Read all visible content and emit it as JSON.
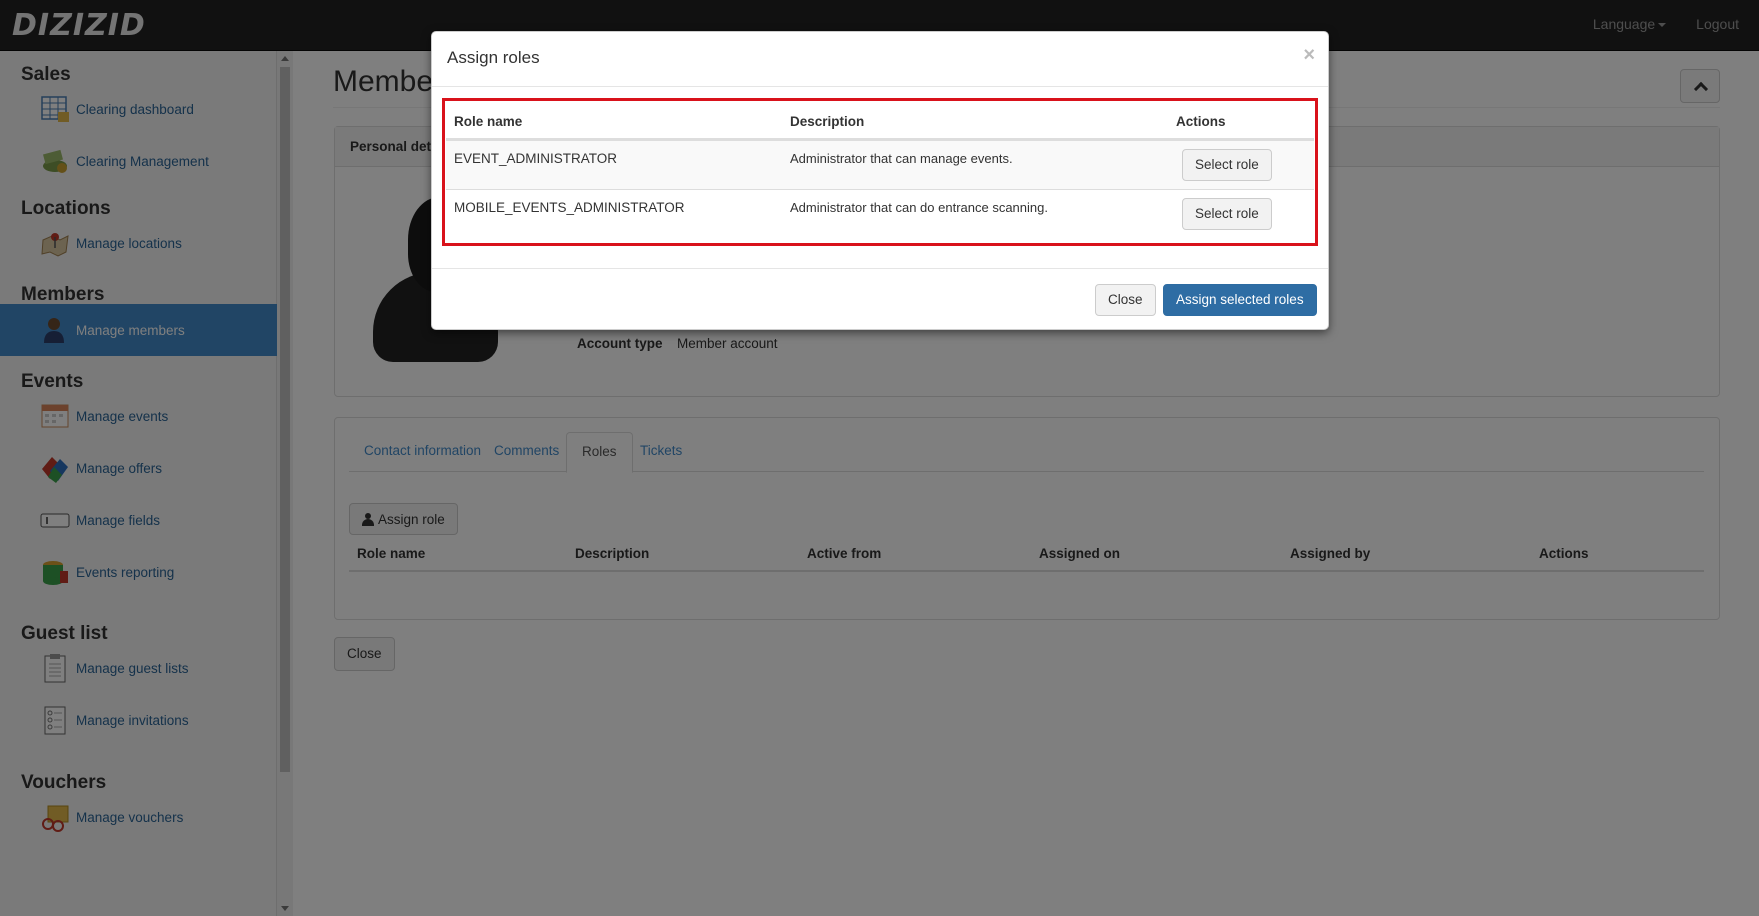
{
  "navbar": {
    "logo": "DIZIZID",
    "language": "Language",
    "logout": "Logout"
  },
  "sidebar": {
    "sections": [
      {
        "title": "Sales",
        "items": [
          {
            "label": "Clearing dashboard",
            "icon": "dashboard-icon"
          },
          {
            "label": "Clearing Management",
            "icon": "money-icon"
          }
        ]
      },
      {
        "title": "Locations",
        "items": [
          {
            "label": "Manage locations",
            "icon": "map-icon"
          }
        ]
      },
      {
        "title": "Members",
        "items": [
          {
            "label": "Manage members",
            "icon": "member-icon",
            "active": true
          }
        ]
      },
      {
        "title": "Events",
        "items": [
          {
            "label": "Manage events",
            "icon": "calendar-icon"
          },
          {
            "label": "Manage offers",
            "icon": "tags-icon"
          },
          {
            "label": "Manage fields",
            "icon": "field-icon"
          },
          {
            "label": "Events reporting",
            "icon": "database-icon"
          }
        ]
      },
      {
        "title": "Guest list",
        "items": [
          {
            "label": "Manage guest lists",
            "icon": "clipboard-icon"
          },
          {
            "label": "Manage invitations",
            "icon": "checklist-icon"
          }
        ]
      },
      {
        "title": "Vouchers",
        "items": [
          {
            "label": "Manage vouchers",
            "icon": "voucher-icon"
          }
        ]
      }
    ]
  },
  "main": {
    "page_title": "Member",
    "panel_heading": "Personal deta",
    "account_type_label": "Account type",
    "account_type_value": "Member account",
    "tabs": [
      "Contact information",
      "Comments",
      "Roles",
      "Tickets"
    ],
    "active_tab": "Roles",
    "assign_role_button": "Assign role",
    "roles_columns": [
      "Role name",
      "Description",
      "Active from",
      "Assigned on",
      "Assigned by",
      "Actions"
    ],
    "close_button": "Close"
  },
  "modal": {
    "title": "Assign roles",
    "close_symbol": "×",
    "columns": [
      "Role name",
      "Description",
      "Actions"
    ],
    "rows": [
      {
        "role": "EVENT_ADMINISTRATOR",
        "description": "Administrator that can manage events.",
        "action": "Select role"
      },
      {
        "role": "MOBILE_EVENTS_ADMINISTRATOR",
        "description": "Administrator that can do entrance scanning.",
        "action": "Select role"
      }
    ],
    "footer_close": "Close",
    "footer_assign": "Assign selected roles",
    "highlight_color": "#d9121b"
  },
  "colors": {
    "navbar_bg": "#222222",
    "link": "#2a6496",
    "active_item": "#428bca",
    "primary": "#2e6da4"
  }
}
